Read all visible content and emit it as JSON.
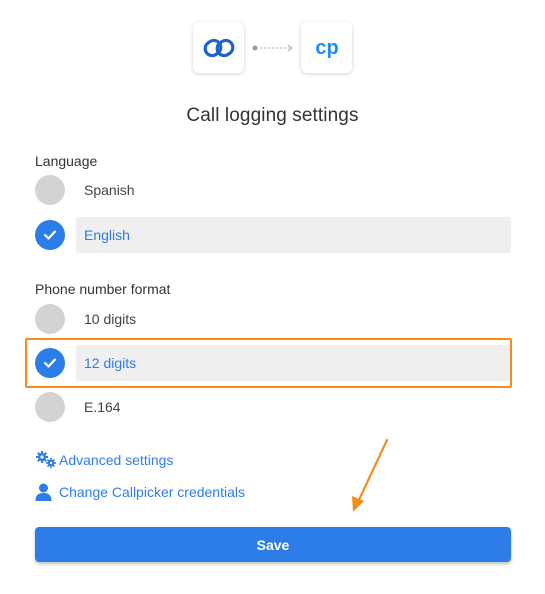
{
  "header": {
    "left_logo_icon": "zoho-link-icon",
    "right_logo_icon": "callpicker-cp-icon",
    "connector_icon": "dotted-arrow-icon",
    "right_logo_text": "cp"
  },
  "title": "Call logging settings",
  "language": {
    "label": "Language",
    "options": [
      {
        "label": "Spanish",
        "selected": false
      },
      {
        "label": "English",
        "selected": true
      }
    ]
  },
  "phone_format": {
    "label": "Phone number format",
    "options": [
      {
        "label": "10 digits",
        "selected": false
      },
      {
        "label": "12 digits",
        "selected": true
      },
      {
        "label": "E.164",
        "selected": false
      }
    ]
  },
  "links": {
    "advanced": "Advanced settings",
    "credentials": "Change Callpicker credentials"
  },
  "save_label": "Save",
  "colors": {
    "accent": "#2d7de8",
    "highlight": "#f28c1c",
    "radio_off": "#d3d3d3",
    "selected_bg": "#efefef"
  }
}
